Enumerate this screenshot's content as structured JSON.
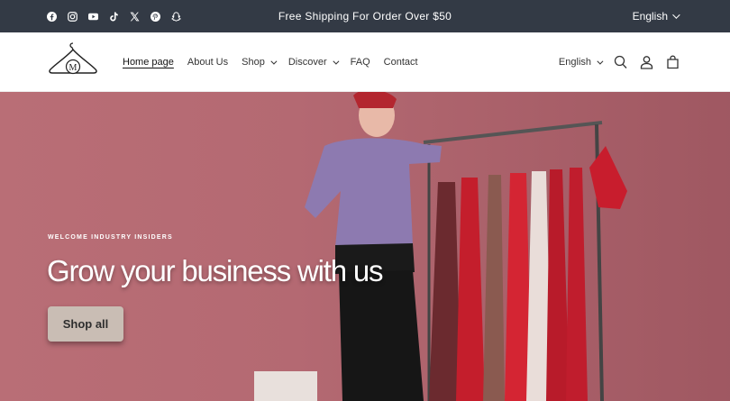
{
  "announcement": {
    "message": "Free Shipping For Order Over $50",
    "language": "English",
    "social_icons": [
      "facebook-icon",
      "instagram-icon",
      "youtube-icon",
      "tiktok-icon",
      "x-icon",
      "pinterest-icon",
      "snapchat-icon"
    ]
  },
  "header": {
    "logo_letter": "M",
    "nav": [
      {
        "label": "Home page",
        "active": true
      },
      {
        "label": "About Us"
      },
      {
        "label": "Shop",
        "dropdown": true
      },
      {
        "label": "Discover",
        "dropdown": true
      },
      {
        "label": "FAQ"
      },
      {
        "label": "Contact"
      }
    ],
    "language": "English",
    "icons": [
      "search-icon",
      "account-icon",
      "cart-icon"
    ]
  },
  "hero": {
    "eyebrow": "WELCOME INDUSTRY INSIDERS",
    "heading": "Grow your business with us",
    "button_label": "Shop all"
  },
  "colors": {
    "announcement_bg": "#333a45",
    "hero_bg": "#b56a73",
    "button_bg": "#c9bdb4"
  }
}
